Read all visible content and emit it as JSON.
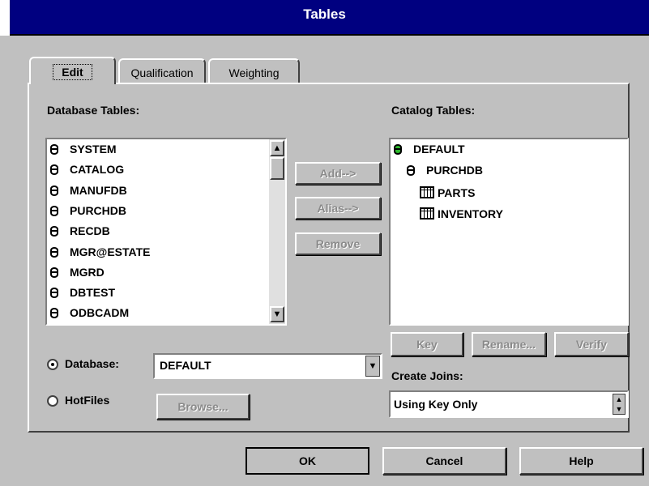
{
  "window": {
    "title": "Tables"
  },
  "tabs": [
    {
      "label": "Edit",
      "active": true
    },
    {
      "label": "Qualification",
      "active": false
    },
    {
      "label": "Weighting",
      "active": false
    }
  ],
  "left": {
    "label": "Database Tables:",
    "items": [
      "SYSTEM",
      "CATALOG",
      "MANUFDB",
      "PURCHDB",
      "RECDB",
      "MGR@ESTATE",
      "MGRD",
      "DBTEST",
      "ODBCADM"
    ]
  },
  "middle_buttons": {
    "add": "Add-->",
    "alias": "Alias-->",
    "remove": "Remove"
  },
  "right": {
    "label": "Catalog Tables:",
    "tree": [
      {
        "label": "DEFAULT",
        "icon": "database-green-icon",
        "level": 0
      },
      {
        "label": "PURCHDB",
        "icon": "database-icon",
        "level": 1
      },
      {
        "label": "PARTS",
        "icon": "table-icon",
        "level": 2
      },
      {
        "label": "INVENTORY",
        "icon": "table-icon",
        "level": 2
      }
    ],
    "buttons": {
      "key": "Key",
      "rename": "Rename...",
      "verify": "Verify"
    }
  },
  "source": {
    "database_label": "Database:",
    "database_value": "DEFAULT",
    "hotfiles_label": "HotFiles",
    "browse_label": "Browse...",
    "selected": "database"
  },
  "joins": {
    "label": "Create Joins:",
    "value": "Using Key Only"
  },
  "footer": {
    "ok": "OK",
    "cancel": "Cancel",
    "help": "Help"
  }
}
